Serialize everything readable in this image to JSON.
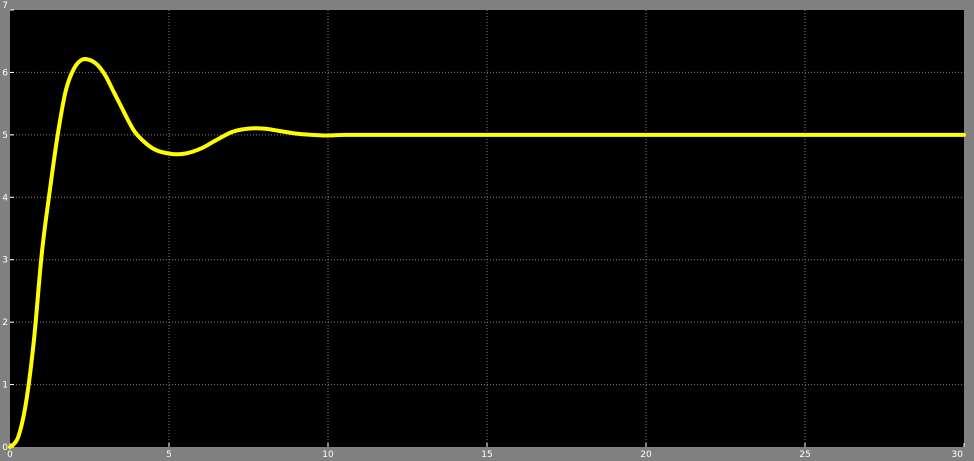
{
  "chart_data": {
    "type": "line",
    "title": "",
    "xlabel": "",
    "ylabel": "",
    "xlim": [
      0,
      30
    ],
    "ylim": [
      0,
      7
    ],
    "grid": true,
    "x_ticks": [
      0,
      5,
      10,
      15,
      20,
      25,
      30
    ],
    "y_ticks": [
      0,
      1,
      2,
      3,
      4,
      5,
      6,
      7
    ],
    "x_tick_labels": [
      "0",
      "5",
      "10",
      "15",
      "20",
      "25",
      "30"
    ],
    "y_tick_labels": [
      "0",
      "1",
      "2",
      "3",
      "4",
      "5",
      "6",
      "7"
    ],
    "series": [
      {
        "x": [
          0,
          0.25,
          0.5,
          0.75,
          1.0,
          1.25,
          1.5,
          1.75,
          2.0,
          2.25,
          2.5,
          2.75,
          3.0,
          3.25,
          3.5,
          3.75,
          4.0,
          4.5,
          5.0,
          5.5,
          6.0,
          6.5,
          7.0,
          7.5,
          8.0,
          8.5,
          9.0,
          9.5,
          10.0,
          10.5,
          11.0,
          12.0,
          14.0,
          16.0,
          18.0,
          20.0,
          22.0,
          24.0,
          26.0,
          28.0,
          30.0
        ],
        "y": [
          0,
          0.15,
          0.7,
          1.7,
          3.1,
          4.1,
          5.0,
          5.7,
          6.05,
          6.2,
          6.2,
          6.12,
          5.95,
          5.7,
          5.45,
          5.2,
          5.0,
          4.78,
          4.7,
          4.7,
          4.78,
          4.92,
          5.05,
          5.1,
          5.1,
          5.06,
          5.02,
          5.0,
          4.99,
          5.0,
          5.0,
          5.0,
          5.0,
          5.0,
          5.0,
          5.0,
          5.0,
          5.0,
          5.0,
          5.0,
          5.0
        ]
      }
    ],
    "colors": {
      "background": "#000000",
      "frame": "#808080",
      "grid": "#808080",
      "line": "#ffff00",
      "text": "#ffffff"
    }
  }
}
